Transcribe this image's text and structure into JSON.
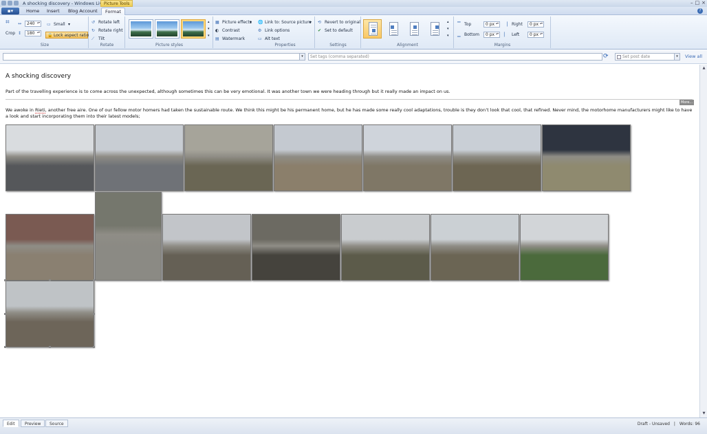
{
  "window": {
    "title": "A shocking discovery - Windows Liv...",
    "contextual_tab": "Picture Tools"
  },
  "tabs": [
    "Home",
    "Insert",
    "Blog Account",
    "Format"
  ],
  "ribbon": {
    "size": {
      "label": "Size",
      "crop": "Crop",
      "width": "240",
      "height": "180",
      "size_preset": "Small",
      "lock_aspect": "Lock aspect ratio"
    },
    "rotate": {
      "label": "Rotate",
      "rotate_left": "Rotate left",
      "rotate_right": "Rotate right",
      "tilt": "Tilt"
    },
    "picture_styles": {
      "label": "Picture styles"
    },
    "effects": {
      "picture_effects": "Picture effects",
      "contrast": "Contrast",
      "watermark": "Watermark"
    },
    "properties": {
      "label": "Properties",
      "link_to": "Link to: Source picture",
      "link_options": "Link options",
      "alt_text": "Alt text"
    },
    "settings": {
      "label": "Settings",
      "revert": "Revert to original",
      "set_default": "Set to default"
    },
    "alignment": {
      "label": "Alignment"
    },
    "margins": {
      "label": "Margins",
      "top": "Top",
      "bottom": "Bottom",
      "right": "Right",
      "left": "Left",
      "top_val": "0 px",
      "bottom_val": "0 px",
      "right_val": "0 px",
      "left_val": "0 px"
    }
  },
  "toolbar": {
    "tags_placeholder": "Set tags (comma separated)",
    "post_date_placeholder": "Set post date",
    "view_all": "View all"
  },
  "post": {
    "title": "A shocking discovery",
    "intro": "Part of the travelling experience is to come across the unexpected, although sometimes this can be very emotional. It was another town we were heading through but it really made an impact on us.",
    "more_label": "More...",
    "body_prefix": "We awoke in ",
    "body_link": "Rieti",
    "body_rest": ", another free aire. One of our fellow motor homers had taken the sustainable route. We think this might be his permanent home, but he has made some really cool adaptations, trouble is they don’t look that cool, that refined. Never mind, the motorhome manufacturers might like to have a look and start incorporating them into their latest models;"
  },
  "photos": [
    {
      "subject": "motorhome-in-car-park",
      "sky": "#d9dcdf",
      "ground": "#55575a"
    },
    {
      "subject": "wet-street-buildings",
      "sky": "#c8cdd3",
      "ground": "#6f7277"
    },
    {
      "subject": "pile-of-rubbish-bags",
      "sky": "#a6a49a",
      "ground": "#6a6654"
    },
    {
      "subject": "white-house-dirt-yard",
      "sky": "#c4c9d0",
      "ground": "#8b7f6b"
    },
    {
      "subject": "derelict-houses",
      "sky": "#cfd4db",
      "ground": "#7f7766"
    },
    {
      "subject": "ruins-with-person",
      "sky": "#c9cfd6",
      "ground": "#6d6653"
    },
    {
      "subject": "fresco-wall",
      "sky": "#2e3440",
      "ground": "#8f8a6f"
    },
    {
      "subject": "red-arch-fresco",
      "sky": "#7a5a52",
      "ground": "#8a8071"
    },
    {
      "subject": "stone-room-interior",
      "sky": "#75776d",
      "ground": "#8b8a84"
    },
    {
      "subject": "ruined-street-walls",
      "sky": "#c2c5c9",
      "ground": "#656055"
    },
    {
      "subject": "stone-tunnel",
      "sky": "#6c6a62",
      "ground": "#45433d"
    },
    {
      "subject": "ruins-with-pots",
      "sky": "#c9cccf",
      "ground": "#5c5b4a"
    },
    {
      "subject": "wall-with-urns",
      "sky": "#cbd0d4",
      "ground": "#6b6554"
    },
    {
      "subject": "green-courtyard-ruins",
      "sky": "#d2d5d8",
      "ground": "#4b6a3c"
    },
    {
      "subject": "column-and-dome",
      "sky": "#bfc3c6",
      "ground": "#6d6559"
    }
  ],
  "status": {
    "tabs": [
      "Edit",
      "Preview",
      "Source"
    ],
    "draft": "Draft - Unsaved",
    "separator": "|",
    "words": "Words: 96"
  }
}
